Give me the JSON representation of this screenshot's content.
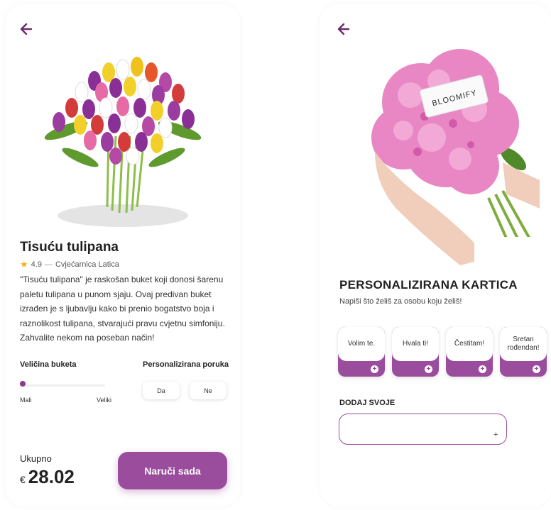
{
  "colors": {
    "accent": "#9b4d9d",
    "star": "#f2b01e",
    "text": "#222222"
  },
  "left_screen": {
    "back_icon": "arrow-left-icon",
    "product": {
      "name": "Tisuću tulipana",
      "rating": "4.9",
      "rating_separator": "—",
      "shop": "Cvjećarnica Latica",
      "description": "\"Tisuću tulipana\" je raskošan buket koji donosi šarenu paletu tulipana u punom sjaju. Ovaj predivan buket izrađen je s ljubavlju kako bi prenio bogatstvo boja i raznolikost tulipana, stvarajući pravu cvjetnu simfoniju. Zahvalite nekom na poseban način!"
    },
    "size": {
      "label": "Veličina buketa",
      "min_label": "Mali",
      "max_label": "Veliki",
      "value_fraction": 0.0
    },
    "message": {
      "label": "Personalizirana poruka",
      "yes": "Da",
      "no": "Ne"
    },
    "total": {
      "label": "Ukupno",
      "currency": "€",
      "amount": "28.02"
    },
    "order_button": "Naruči sada"
  },
  "right_screen": {
    "back_icon": "arrow-left-icon",
    "photo_card_text": "BLOOMIFY",
    "title": "PERSONALIZIRANA KARTICA",
    "subtitle": "Napiši što želiš za osobu koju želiš!",
    "message_options": [
      "Volim te.",
      "Hvala ti!",
      "Čestitam!",
      "Sretan rođendan!"
    ],
    "add_own_label": "DODAJ SVOJE",
    "add_own_value": "",
    "add_icon": "plus-icon"
  }
}
